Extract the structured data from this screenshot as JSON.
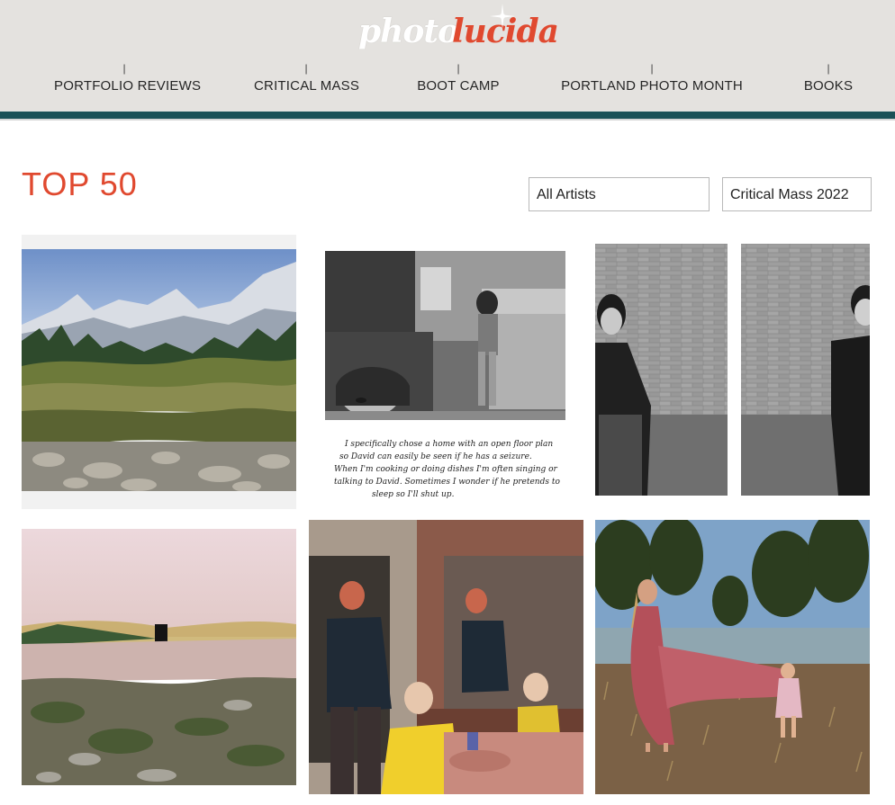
{
  "logo": {
    "part1": "photo",
    "part2": "lucida"
  },
  "nav": [
    {
      "label": "PORTFOLIO REVIEWS"
    },
    {
      "label": "CRITICAL MASS"
    },
    {
      "label": "BOOT CAMP"
    },
    {
      "label": "PORTLAND PHOTO MONTH"
    },
    {
      "label": "BOOKS"
    }
  ],
  "page": {
    "title": "TOP 50"
  },
  "filters": {
    "artists": "All Artists",
    "program": "Critical Mass 2022"
  },
  "photos": {
    "p2_caption_line1": "I specifically chose a home with an open floor plan",
    "p2_caption_line2": "so David can easily be seen if he has a seizure.",
    "p2_caption_line3": "When I'm cooking or doing dishes I'm often singing or",
    "p2_caption_line4": "talking to David. Sometimes I wonder if he pretends to",
    "p2_caption_line5": "sleep so I'll shut up."
  },
  "colors": {
    "accent": "#e0492f",
    "header_bg": "#e4e2df",
    "teal": "#1b5157"
  }
}
